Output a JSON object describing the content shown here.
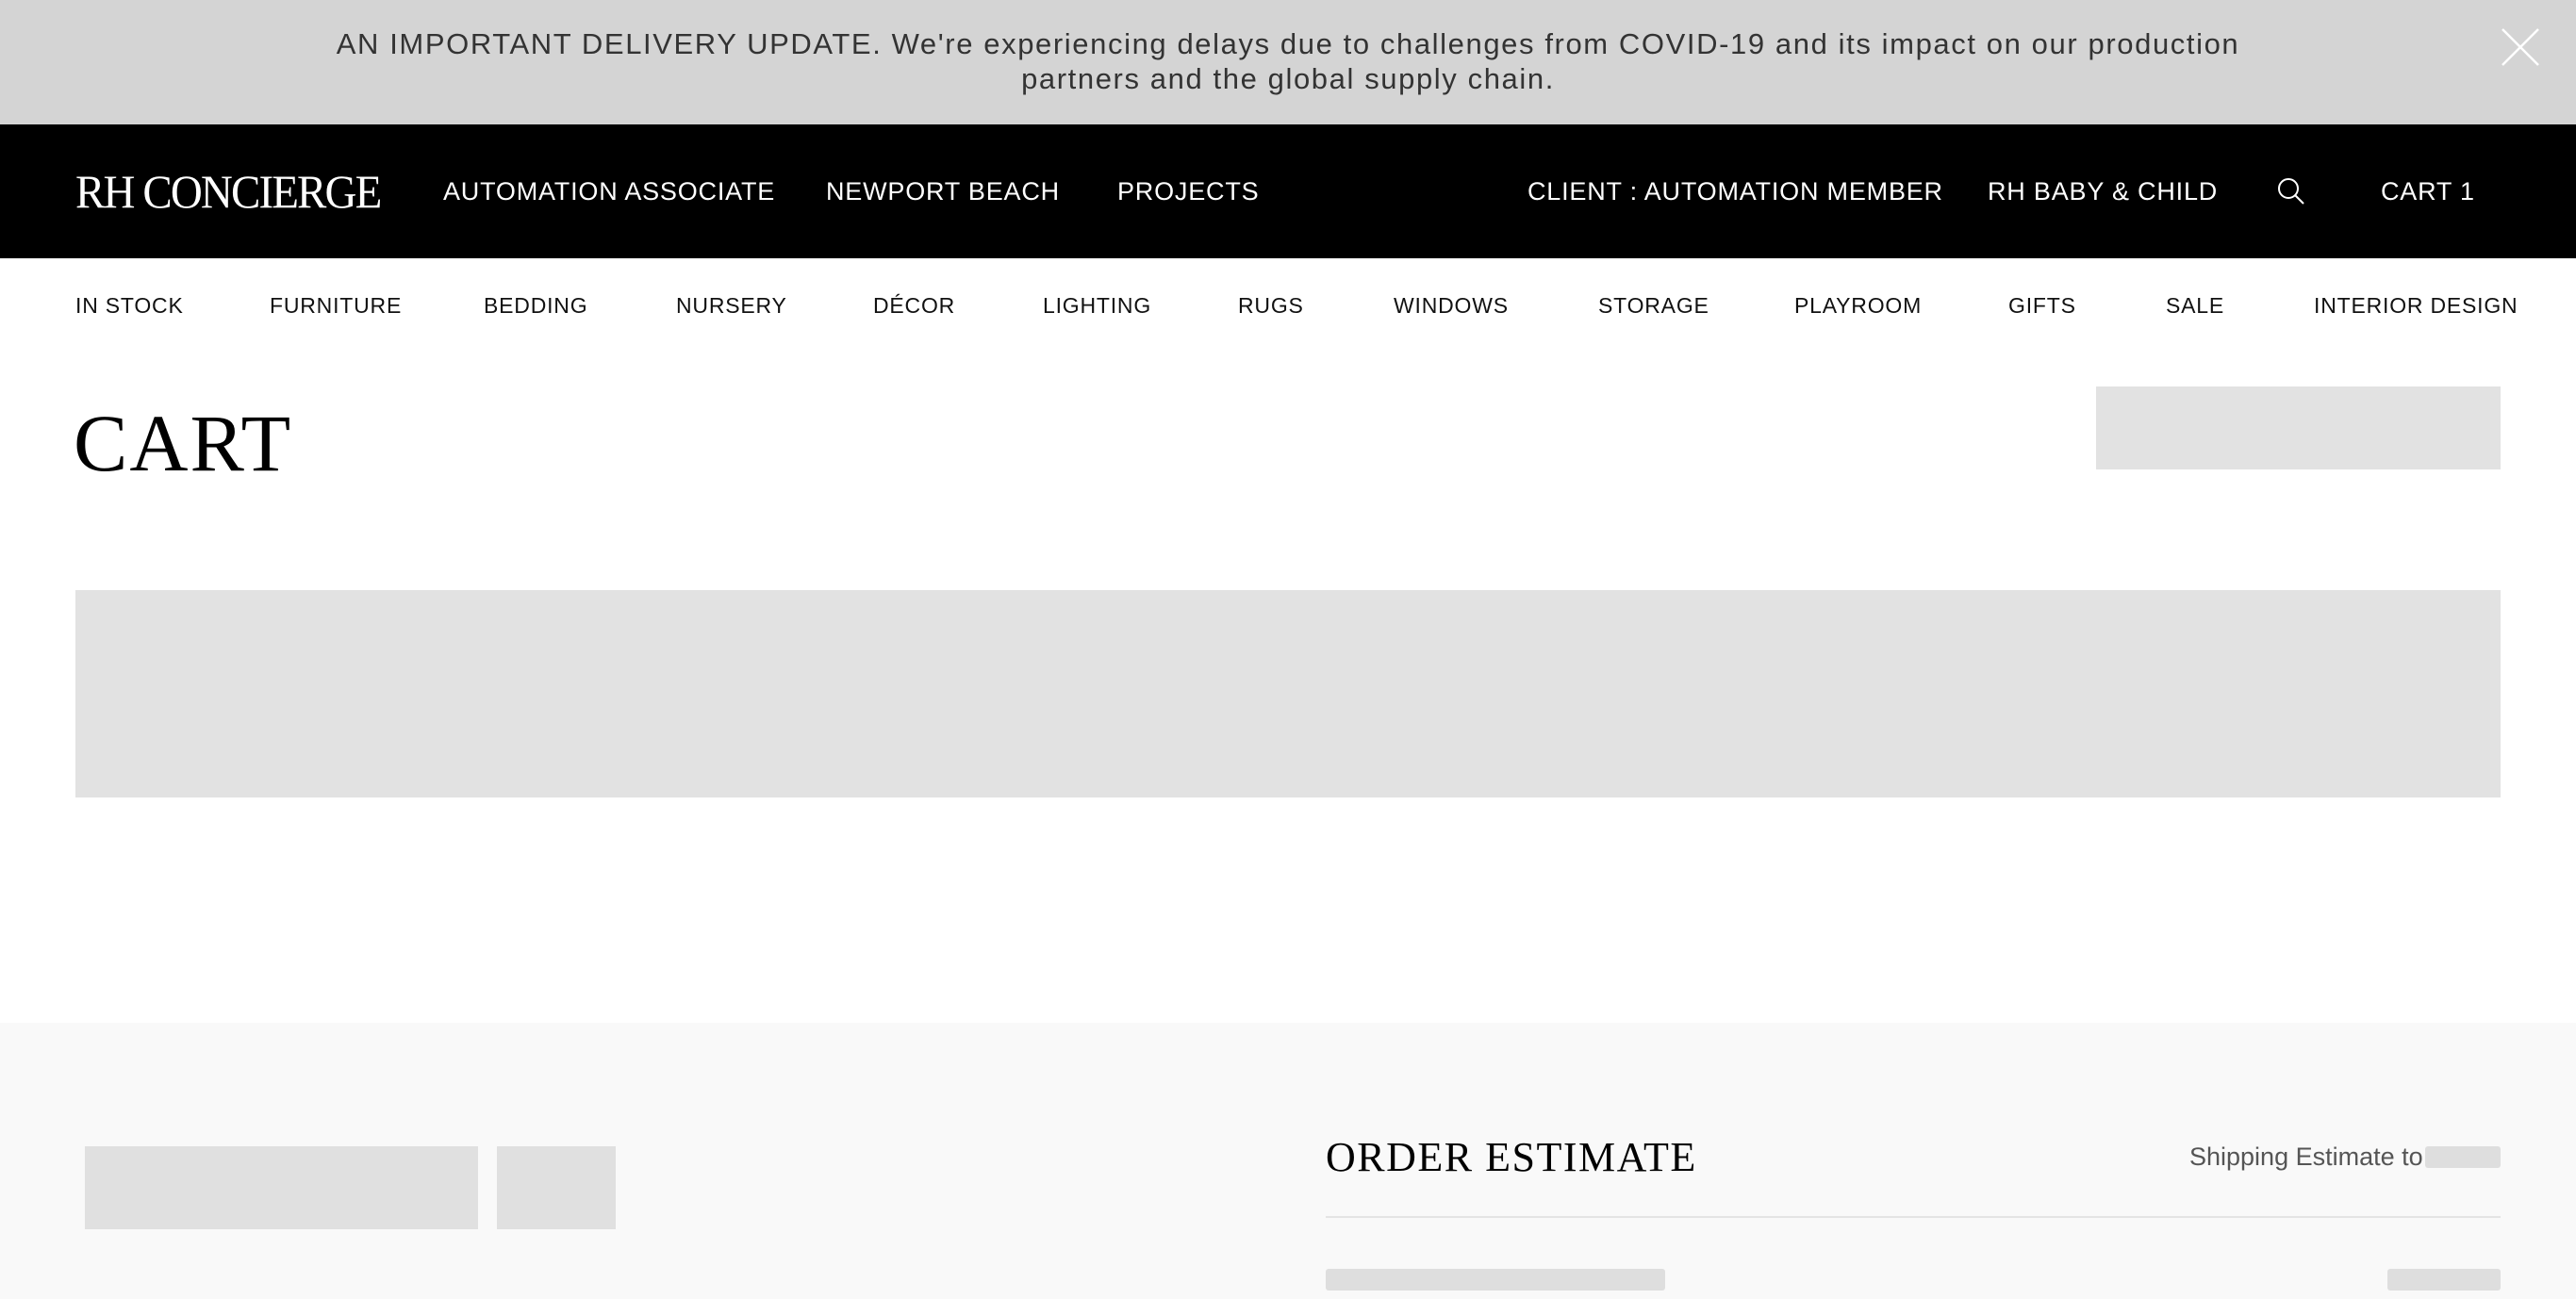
{
  "banner": {
    "message": "AN IMPORTANT DELIVERY UPDATE. We're experiencing delays due to challenges from COVID-19 and its impact on our production partners and the global supply chain.",
    "close_icon": "close-icon"
  },
  "header": {
    "logo": "RH CONCIERGE",
    "nav_left": [
      "AUTOMATION ASSOCIATE",
      "NEWPORT BEACH",
      "PROJECTS"
    ],
    "client": "CLIENT : AUTOMATION MEMBER",
    "brand_link": "RH BABY & CHILD",
    "search_icon": "search-icon",
    "cart": "CART 1"
  },
  "categories": [
    "IN STOCK",
    "FURNITURE",
    "BEDDING",
    "NURSERY",
    "DÉCOR",
    "LIGHTING",
    "RUGS",
    "WINDOWS",
    "STORAGE",
    "PLAYROOM",
    "GIFTS",
    "SALE",
    "INTERIOR DESIGN"
  ],
  "page": {
    "title": "CART"
  },
  "order_estimate": {
    "title": "ORDER ESTIMATE",
    "shipping_label": "Shipping Estimate to"
  },
  "colors": {
    "banner_bg": "#d4d4d4",
    "nav_bg": "#000000",
    "skeleton": "#e2e2e2",
    "summary_bg": "#f9f9f9"
  }
}
